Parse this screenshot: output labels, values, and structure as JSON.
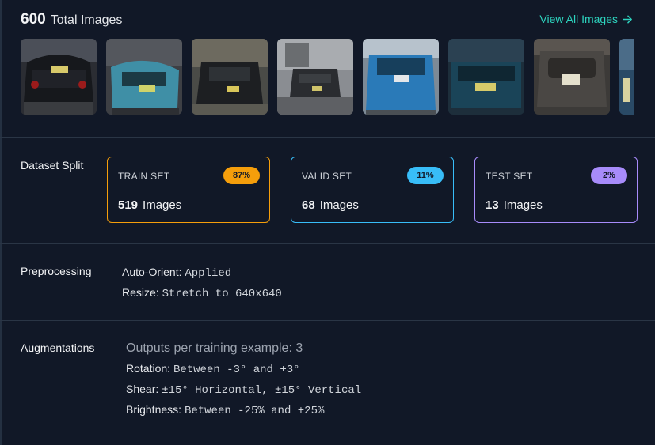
{
  "header": {
    "total_count": "600",
    "total_label": "Total Images",
    "view_all_label": "View All Images"
  },
  "thumbnails": [
    {
      "alt": "car-rear-1"
    },
    {
      "alt": "car-rear-2"
    },
    {
      "alt": "car-rear-3"
    },
    {
      "alt": "truck-rear-4"
    },
    {
      "alt": "suv-rear-5"
    },
    {
      "alt": "car-rear-6"
    },
    {
      "alt": "suv-front-7"
    },
    {
      "alt": "partial-8"
    }
  ],
  "split": {
    "title": "Dataset Split",
    "train": {
      "name": "TRAIN SET",
      "percent": "87%",
      "count": "519",
      "unit": "Images"
    },
    "valid": {
      "name": "VALID SET",
      "percent": "11%",
      "count": "68",
      "unit": "Images"
    },
    "test": {
      "name": "TEST SET",
      "percent": "2%",
      "count": "13",
      "unit": "Images"
    }
  },
  "preprocessing": {
    "title": "Preprocessing",
    "items": [
      {
        "key": "Auto-Orient:",
        "value": "Applied"
      },
      {
        "key": "Resize:",
        "value": "Stretch to 640x640"
      }
    ]
  },
  "augmentations": {
    "title": "Augmentations",
    "outputs": "Outputs per training example: 3",
    "items": [
      {
        "key": "Rotation:",
        "value": "Between -3° and +3°"
      },
      {
        "key": "Shear:",
        "value": "±15° Horizontal, ±15° Vertical"
      },
      {
        "key": "Brightness:",
        "value": "Between -25% and +25%"
      }
    ]
  },
  "colors": {
    "background": "#111827",
    "accent": "#2dd4bf",
    "train": "#f59e0b",
    "valid": "#38bdf8",
    "test": "#a78bfa"
  }
}
